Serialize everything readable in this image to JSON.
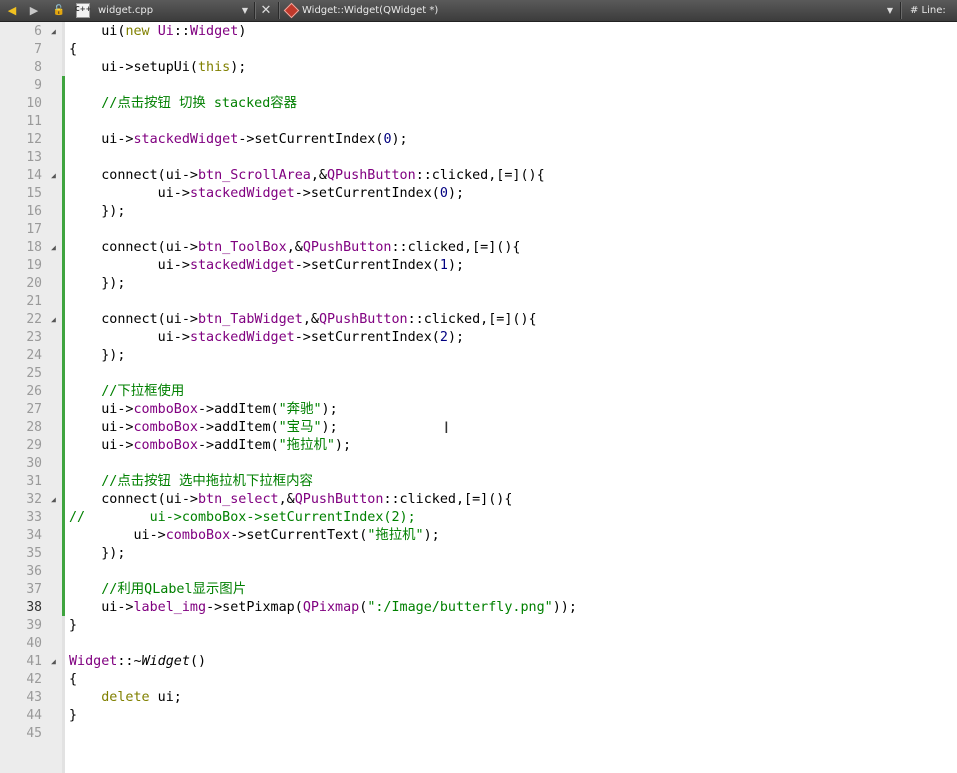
{
  "toolbar": {
    "file_name": "widget.cpp",
    "file_icon_text": "C++",
    "symbol": "Widget::Widget(QWidget *)",
    "line_label": "#  Line:"
  },
  "editor": {
    "lines": [
      {
        "n": "6",
        "fold": true,
        "mod": false,
        "tokens": [
          [
            "",
            "    "
          ],
          [
            "",
            "ui("
          ],
          [
            "kw",
            "new"
          ],
          [
            "",
            " "
          ],
          [
            "ty",
            "Ui"
          ],
          [
            "",
            "::"
          ],
          [
            "ty",
            "Widget"
          ],
          [
            "",
            ")"
          ]
        ]
      },
      {
        "n": "7",
        "fold": false,
        "mod": false,
        "tokens": [
          [
            "",
            "{"
          ]
        ]
      },
      {
        "n": "8",
        "fold": false,
        "mod": false,
        "tokens": [
          [
            "",
            "    ui->setupUi("
          ],
          [
            "kw",
            "this"
          ],
          [
            "",
            ");"
          ]
        ]
      },
      {
        "n": "9",
        "fold": false,
        "mod": true,
        "tokens": []
      },
      {
        "n": "10",
        "fold": false,
        "mod": true,
        "tokens": [
          [
            "",
            "    "
          ],
          [
            "cm",
            "//点击按钮 切换 stacked容器"
          ]
        ]
      },
      {
        "n": "11",
        "fold": false,
        "mod": true,
        "tokens": []
      },
      {
        "n": "12",
        "fold": false,
        "mod": true,
        "tokens": [
          [
            "",
            "    ui->"
          ],
          [
            "ty",
            "stackedWidget"
          ],
          [
            "",
            "->setCurrentIndex("
          ],
          [
            "nm",
            "0"
          ],
          [
            "",
            ");"
          ]
        ]
      },
      {
        "n": "13",
        "fold": false,
        "mod": true,
        "tokens": []
      },
      {
        "n": "14",
        "fold": true,
        "mod": true,
        "tokens": [
          [
            "",
            "    connect(ui->"
          ],
          [
            "ty",
            "btn_ScrollArea"
          ],
          [
            "",
            ",&"
          ],
          [
            "ty",
            "QPushButton"
          ],
          [
            "",
            "::clicked,[=](){"
          ]
        ]
      },
      {
        "n": "15",
        "fold": false,
        "mod": true,
        "tokens": [
          [
            "",
            "           ui->"
          ],
          [
            "ty",
            "stackedWidget"
          ],
          [
            "",
            "->setCurrentIndex("
          ],
          [
            "nm",
            "0"
          ],
          [
            "",
            ");"
          ]
        ]
      },
      {
        "n": "16",
        "fold": false,
        "mod": true,
        "tokens": [
          [
            "",
            "    });"
          ]
        ]
      },
      {
        "n": "17",
        "fold": false,
        "mod": true,
        "tokens": []
      },
      {
        "n": "18",
        "fold": true,
        "mod": true,
        "tokens": [
          [
            "",
            "    connect(ui->"
          ],
          [
            "ty",
            "btn_ToolBox"
          ],
          [
            "",
            ",&"
          ],
          [
            "ty",
            "QPushButton"
          ],
          [
            "",
            "::clicked,[=](){"
          ]
        ]
      },
      {
        "n": "19",
        "fold": false,
        "mod": true,
        "tokens": [
          [
            "",
            "           ui->"
          ],
          [
            "ty",
            "stackedWidget"
          ],
          [
            "",
            "->setCurrentIndex("
          ],
          [
            "nm",
            "1"
          ],
          [
            "",
            ");"
          ]
        ]
      },
      {
        "n": "20",
        "fold": false,
        "mod": true,
        "tokens": [
          [
            "",
            "    });"
          ]
        ]
      },
      {
        "n": "21",
        "fold": false,
        "mod": true,
        "tokens": []
      },
      {
        "n": "22",
        "fold": true,
        "mod": true,
        "tokens": [
          [
            "",
            "    connect(ui->"
          ],
          [
            "ty",
            "btn_TabWidget"
          ],
          [
            "",
            ",&"
          ],
          [
            "ty",
            "QPushButton"
          ],
          [
            "",
            "::clicked,[=](){"
          ]
        ]
      },
      {
        "n": "23",
        "fold": false,
        "mod": true,
        "tokens": [
          [
            "",
            "           ui->"
          ],
          [
            "ty",
            "stackedWidget"
          ],
          [
            "",
            "->setCurrentIndex("
          ],
          [
            "nm",
            "2"
          ],
          [
            "",
            ");"
          ]
        ]
      },
      {
        "n": "24",
        "fold": false,
        "mod": true,
        "tokens": [
          [
            "",
            "    });"
          ]
        ]
      },
      {
        "n": "25",
        "fold": false,
        "mod": true,
        "tokens": []
      },
      {
        "n": "26",
        "fold": false,
        "mod": true,
        "tokens": [
          [
            "",
            "    "
          ],
          [
            "cm",
            "//下拉框使用"
          ]
        ]
      },
      {
        "n": "27",
        "fold": false,
        "mod": true,
        "tokens": [
          [
            "",
            "    ui->"
          ],
          [
            "ty",
            "comboBox"
          ],
          [
            "",
            "->addItem("
          ],
          [
            "st",
            "\"奔驰\""
          ],
          [
            "",
            ");"
          ]
        ]
      },
      {
        "n": "28",
        "fold": false,
        "mod": true,
        "tokens": [
          [
            "",
            "    ui->"
          ],
          [
            "ty",
            "comboBox"
          ],
          [
            "",
            "->addItem("
          ],
          [
            "st",
            "\"宝马\""
          ],
          [
            "",
            ");"
          ]
        ]
      },
      {
        "n": "29",
        "fold": false,
        "mod": true,
        "tokens": [
          [
            "",
            "    ui->"
          ],
          [
            "ty",
            "comboBox"
          ],
          [
            "",
            "->addItem("
          ],
          [
            "st",
            "\"拖拉机\""
          ],
          [
            "",
            ");"
          ]
        ]
      },
      {
        "n": "30",
        "fold": false,
        "mod": true,
        "tokens": []
      },
      {
        "n": "31",
        "fold": false,
        "mod": true,
        "tokens": [
          [
            "",
            "    "
          ],
          [
            "cm",
            "//点击按钮 选中拖拉机下拉框内容"
          ]
        ]
      },
      {
        "n": "32",
        "fold": true,
        "mod": true,
        "tokens": [
          [
            "",
            "    connect(ui->"
          ],
          [
            "ty",
            "btn_select"
          ],
          [
            "",
            ",&"
          ],
          [
            "ty",
            "QPushButton"
          ],
          [
            "",
            "::clicked,[=](){"
          ]
        ]
      },
      {
        "n": "33",
        "fold": false,
        "mod": true,
        "tokens": [
          [
            "cm",
            "//        ui->comboBox->setCurrentIndex(2);"
          ]
        ]
      },
      {
        "n": "34",
        "fold": false,
        "mod": true,
        "tokens": [
          [
            "",
            "        ui->"
          ],
          [
            "ty",
            "comboBox"
          ],
          [
            "",
            "->setCurrentText("
          ],
          [
            "st",
            "\"拖拉机\""
          ],
          [
            "",
            ");"
          ]
        ]
      },
      {
        "n": "35",
        "fold": false,
        "mod": true,
        "tokens": [
          [
            "",
            "    });"
          ]
        ]
      },
      {
        "n": "36",
        "fold": false,
        "mod": true,
        "tokens": []
      },
      {
        "n": "37",
        "fold": false,
        "mod": true,
        "tokens": [
          [
            "",
            "    "
          ],
          [
            "cm",
            "//利用QLabel显示图片"
          ]
        ]
      },
      {
        "n": "38",
        "fold": false,
        "mod": true,
        "current": true,
        "tokens": [
          [
            "",
            "    ui->"
          ],
          [
            "ty",
            "label_img"
          ],
          [
            "",
            "->setPixmap("
          ],
          [
            "ty",
            "QPixmap"
          ],
          [
            "",
            "("
          ],
          [
            "st",
            "\":/Image/butterfly.png\""
          ],
          [
            "",
            "));"
          ]
        ]
      },
      {
        "n": "39",
        "fold": false,
        "mod": false,
        "tokens": [
          [
            "",
            "}"
          ]
        ]
      },
      {
        "n": "40",
        "fold": false,
        "mod": false,
        "tokens": []
      },
      {
        "n": "41",
        "fold": true,
        "mod": false,
        "tokens": [
          [
            "ty",
            "Widget"
          ],
          [
            "",
            "::~"
          ],
          [
            "fn",
            "Widget"
          ],
          [
            "",
            "()"
          ]
        ]
      },
      {
        "n": "42",
        "fold": false,
        "mod": false,
        "tokens": [
          [
            "",
            "{"
          ]
        ]
      },
      {
        "n": "43",
        "fold": false,
        "mod": false,
        "tokens": [
          [
            "",
            "    "
          ],
          [
            "kw",
            "delete"
          ],
          [
            "",
            " ui;"
          ]
        ]
      },
      {
        "n": "44",
        "fold": false,
        "mod": false,
        "tokens": [
          [
            "",
            "}"
          ]
        ]
      },
      {
        "n": "45",
        "fold": false,
        "mod": false,
        "tokens": []
      }
    ]
  }
}
